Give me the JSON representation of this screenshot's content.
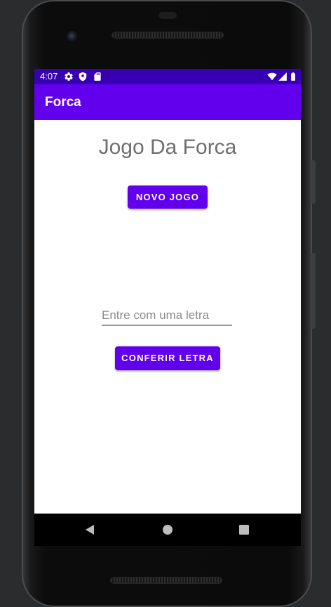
{
  "status_bar": {
    "time": "4:07",
    "icons_left": [
      "gear-icon",
      "shield-icon",
      "sd-card-icon"
    ],
    "icons_right": [
      "wifi-icon",
      "signal-icon",
      "battery-icon"
    ]
  },
  "app_bar": {
    "title": "Forca"
  },
  "main": {
    "title": "Jogo Da Forca",
    "new_game_label": "NOVO JOGO",
    "letter_input": {
      "placeholder": "Entre com uma letra",
      "value": ""
    },
    "check_letter_label": "CONFERIR LETRA"
  },
  "navigation": {
    "buttons": [
      "back-icon",
      "home-icon",
      "recents-icon"
    ]
  },
  "colors": {
    "primary": "#6200ee",
    "primary_dark": "#3700b3",
    "title_text": "#6f6f6f",
    "background": "#ffffff"
  }
}
